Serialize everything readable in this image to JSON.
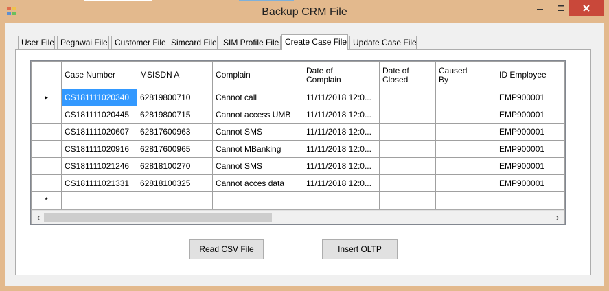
{
  "window": {
    "title": "Backup CRM File",
    "minimize": "–",
    "maximize": "☐",
    "close": "✕"
  },
  "tabs": [
    "User File",
    "Pegawai File",
    "Customer File",
    "Simcard File",
    "SIM Profile File",
    "Create Case File",
    "Update Case File"
  ],
  "active_tab": "Create Case File",
  "grid": {
    "columns": [
      "Case Number",
      "MSISDN A",
      "Complain",
      "Date of Complain",
      "Date of Closed",
      "Caused By",
      "ID Employee"
    ],
    "rows": [
      [
        "CS181111020340",
        "62819800710",
        "Cannot call",
        "11/11/2018 12:0...",
        "",
        "",
        "EMP900001"
      ],
      [
        "CS181111020445",
        "62819800715",
        "Cannot access UMB",
        "11/11/2018 12:0...",
        "",
        "",
        "EMP900001"
      ],
      [
        "CS181111020607",
        "62817600963",
        "Cannot SMS",
        "11/11/2018 12:0...",
        "",
        "",
        "EMP900001"
      ],
      [
        "CS181111020916",
        "62817600965",
        "Cannot MBanking",
        "11/11/2018 12:0...",
        "",
        "",
        "EMP900001"
      ],
      [
        "CS181111021246",
        "62818100270",
        "Cannot SMS",
        "11/11/2018 12:0...",
        "",
        "",
        "EMP900001"
      ],
      [
        "CS181111021331",
        "62818100325",
        "Cannot acces data",
        "11/11/2018 12:0...",
        "",
        "",
        "EMP900001"
      ]
    ],
    "current_row_marker": "▸",
    "new_row_marker": "*"
  },
  "buttons": {
    "read_csv": "Read CSV File",
    "insert_oltp": "Insert OLTP"
  }
}
